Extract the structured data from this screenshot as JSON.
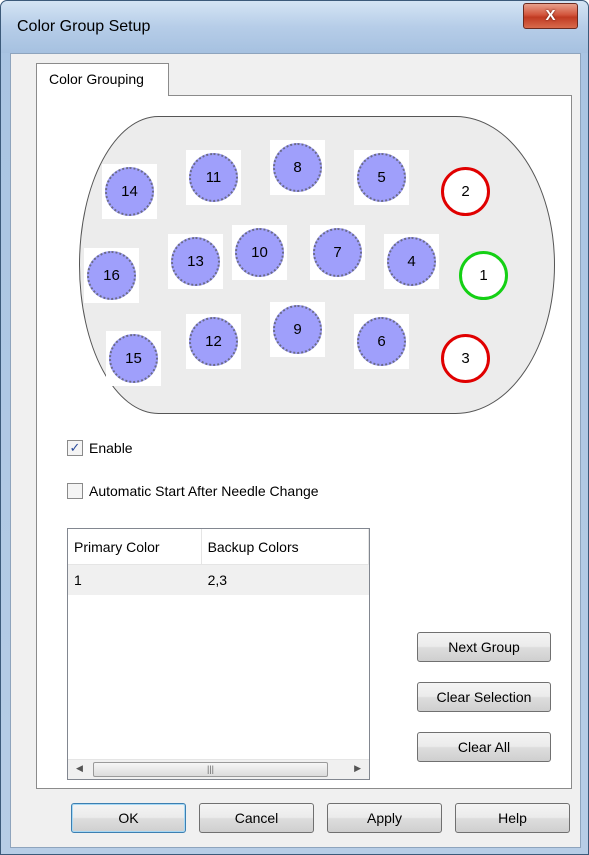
{
  "window": {
    "title": "Color Group Setup",
    "close_label": "X"
  },
  "tabs": [
    {
      "label": "Color Grouping"
    }
  ],
  "needles": [
    {
      "id": "14",
      "style": "blue"
    },
    {
      "id": "11",
      "style": "blue"
    },
    {
      "id": "8",
      "style": "blue"
    },
    {
      "id": "5",
      "style": "blue"
    },
    {
      "id": "2",
      "style": "red-ring"
    },
    {
      "id": "16",
      "style": "blue"
    },
    {
      "id": "13",
      "style": "blue"
    },
    {
      "id": "10",
      "style": "blue"
    },
    {
      "id": "7",
      "style": "blue"
    },
    {
      "id": "4",
      "style": "blue"
    },
    {
      "id": "1",
      "style": "green-ring"
    },
    {
      "id": "15",
      "style": "blue"
    },
    {
      "id": "12",
      "style": "blue"
    },
    {
      "id": "9",
      "style": "blue"
    },
    {
      "id": "6",
      "style": "blue"
    },
    {
      "id": "3",
      "style": "red-ring"
    }
  ],
  "colors": {
    "needle_fill": "#9f9ffb",
    "primary_ring": "#14d014",
    "backup_ring": "#e00000",
    "board": "#ececec"
  },
  "options": {
    "enable": {
      "label": "Enable",
      "checked": true
    },
    "auto_start": {
      "label": "Automatic Start After Needle Change",
      "checked": false
    }
  },
  "group_table": {
    "columns": [
      "Primary Color",
      "Backup Colors"
    ],
    "rows": [
      [
        "1",
        "2,3"
      ]
    ]
  },
  "side_buttons": {
    "next_group": "Next Group",
    "clear_selection": "Clear Selection",
    "clear_all": "Clear All"
  },
  "footer": {
    "ok": "OK",
    "cancel": "Cancel",
    "apply": "Apply",
    "help": "Help"
  }
}
